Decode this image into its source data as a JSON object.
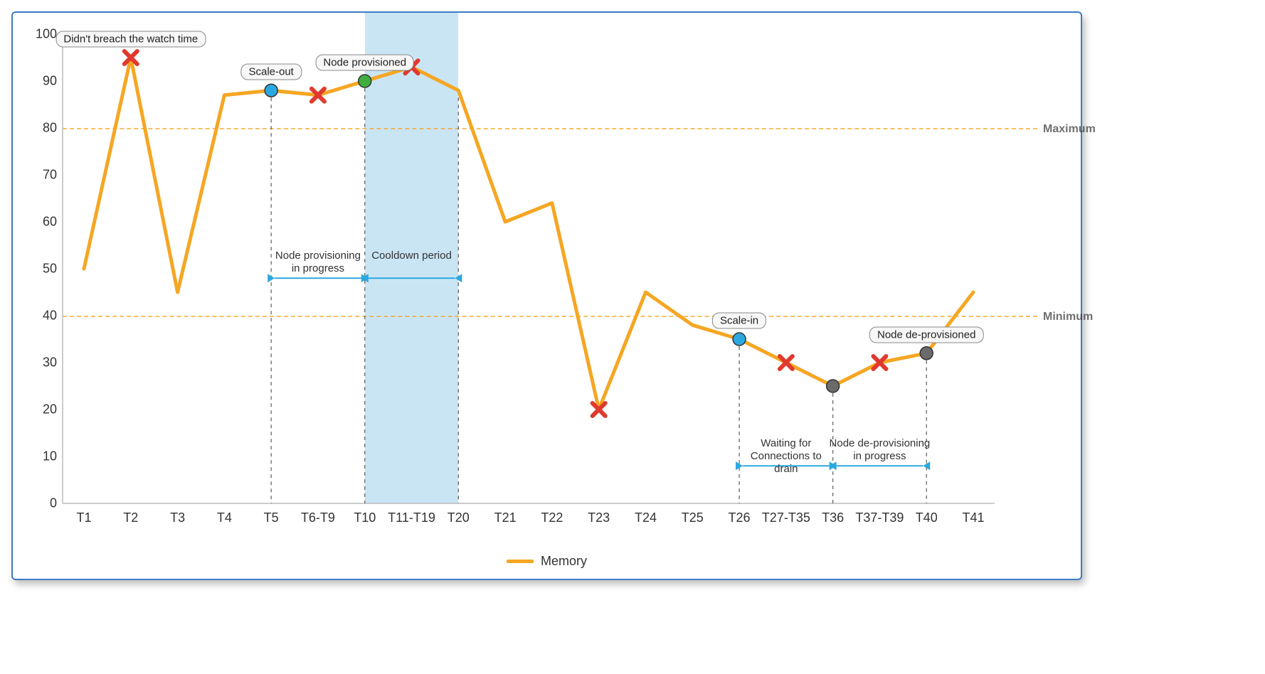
{
  "chart_data": {
    "type": "line",
    "xlabel": "",
    "ylabel": "",
    "title": "",
    "ylim": [
      0,
      100
    ],
    "categories": [
      "T1",
      "T2",
      "T3",
      "T4",
      "T5",
      "T6-T9",
      "T10",
      "T11-T19",
      "T20",
      "T21",
      "T22",
      "T23",
      "T24",
      "T25",
      "T26",
      "T27-T35",
      "T36",
      "T37-T39",
      "T40",
      "T41"
    ],
    "series": [
      {
        "name": "Memory",
        "values": [
          50,
          95,
          45,
          87,
          88,
          87,
          90,
          93,
          88,
          60,
          64,
          20,
          45,
          38,
          35,
          30,
          25,
          30,
          32,
          45
        ]
      }
    ],
    "threshold_lines": [
      {
        "label": "Maximum",
        "y": 80
      },
      {
        "label": "Minimum",
        "y": 40
      }
    ],
    "annotations": {
      "pills": [
        {
          "at": "T2",
          "text": "Didn't breach the watch time"
        },
        {
          "at": "T5",
          "text": "Scale-out"
        },
        {
          "at": "T10",
          "text": "Node provisioned"
        },
        {
          "at": "T26",
          "text": "Scale-in"
        },
        {
          "at": "T40",
          "text": "Node de-provisioned"
        }
      ],
      "markers_red_x": [
        "T2",
        "T6-T9",
        "T11-T19",
        "T23",
        "T27-T35",
        "T37-T39"
      ],
      "marker_blue": [
        "T5",
        "T26"
      ],
      "marker_green": [
        "T10"
      ],
      "marker_grey": [
        "T36",
        "T40"
      ],
      "ranges": [
        {
          "from": "T5",
          "to": "T10",
          "label": "Node provisioning in progress"
        },
        {
          "from": "T10",
          "to": "T20",
          "label": "Cooldown period",
          "shade": true
        },
        {
          "from": "T26",
          "to": "T36",
          "label": "Waiting for Connections to drain"
        },
        {
          "from": "T36",
          "to": "T40",
          "label": "Node de-provisioning in progress"
        }
      ]
    }
  },
  "legend_label": "Memory"
}
